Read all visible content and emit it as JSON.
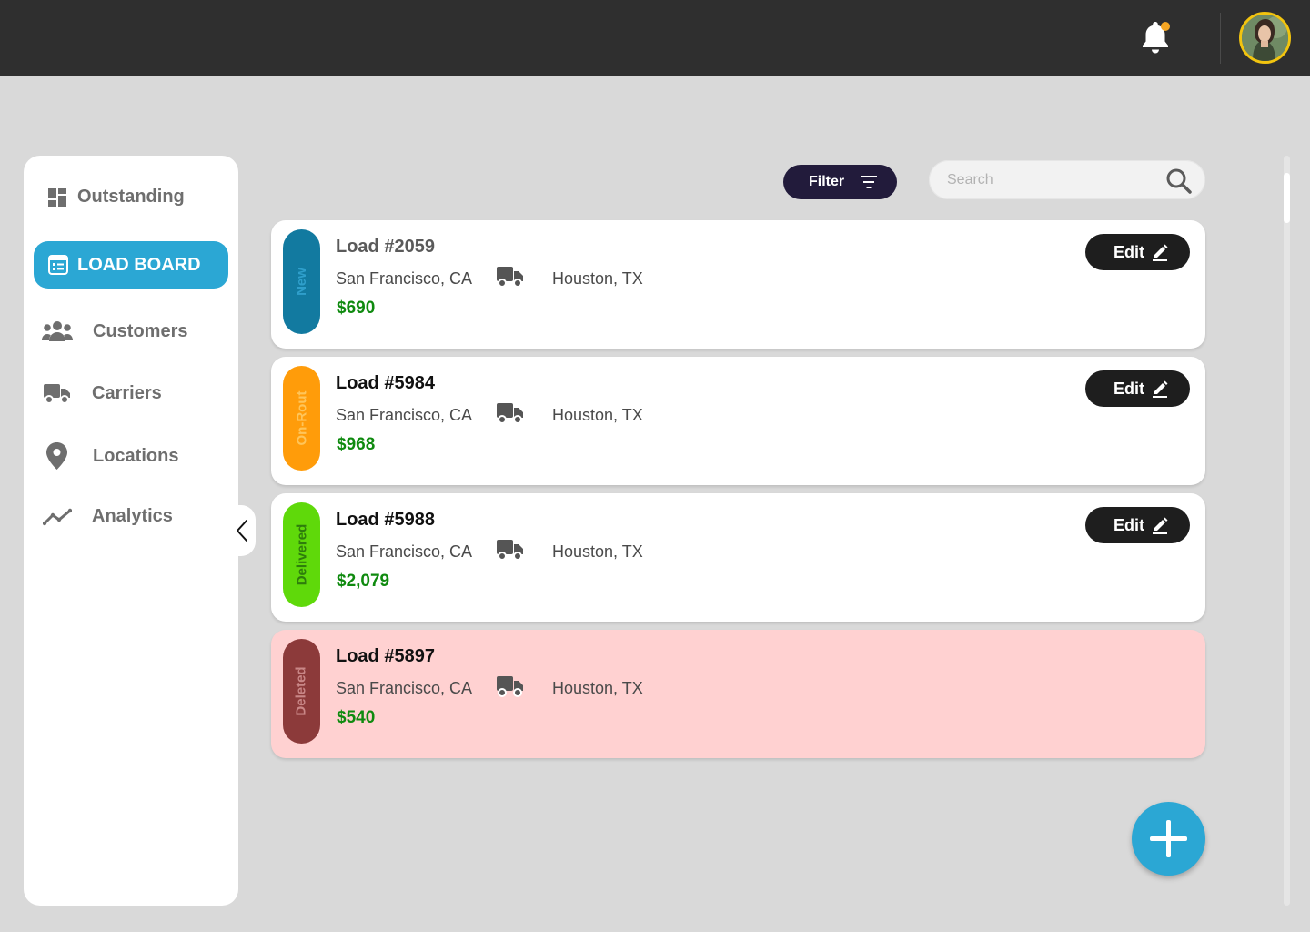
{
  "topbar": {
    "bell_icon": "bell-icon",
    "notification_dot_color": "#f5a623",
    "avatar_border_color": "#f2c40f"
  },
  "sidebar": {
    "items": [
      {
        "label": "Outstanding",
        "icon": "dashboard-grid-icon",
        "active": false
      },
      {
        "label": "LOAD BOARD",
        "icon": "list-board-icon",
        "active": true
      },
      {
        "label": "Customers",
        "icon": "users-icon",
        "active": false
      },
      {
        "label": "Carriers",
        "icon": "truck-icon",
        "active": false
      },
      {
        "label": "Locations",
        "icon": "map-pin-icon",
        "active": false
      },
      {
        "label": "Analytics",
        "icon": "trend-line-icon",
        "active": false
      }
    ],
    "active_color": "#2ba7d4"
  },
  "toolbar": {
    "filter_label": "Filter",
    "search_placeholder": "Search"
  },
  "loads": [
    {
      "status": "New",
      "status_color": "#127aa0",
      "status_text_color": "#2f9fcb",
      "title": "Load #2059",
      "title_color": "#5a5a5a",
      "from": "San Francisco, CA",
      "to": "Houston, TX",
      "price": "$690",
      "edit_label": "Edit"
    },
    {
      "status": "On-Rout",
      "status_color": "#ff9c0a",
      "status_text_color": "#ffc55a",
      "title": "Load #5984",
      "title_color": "#111111",
      "from": "San Francisco, CA",
      "to": "Houston, TX",
      "price": "$968",
      "edit_label": "Edit"
    },
    {
      "status": "Delivered",
      "status_color": "#5fd90a",
      "status_text_color": "#2e7d0c",
      "title": "Load #5988",
      "title_color": "#111111",
      "from": "San Francisco, CA",
      "to": "Houston, TX",
      "price": "$2,079",
      "edit_label": "Edit"
    },
    {
      "status": "Deleted",
      "status_color": "#8c3a3a",
      "status_text_color": "#c98787",
      "title": "Load #5897",
      "title_color": "#111111",
      "from": "San Francisco, CA",
      "to": "Houston, TX",
      "price": "$540",
      "deleted": true
    }
  ],
  "fab_icon": "plus-icon"
}
